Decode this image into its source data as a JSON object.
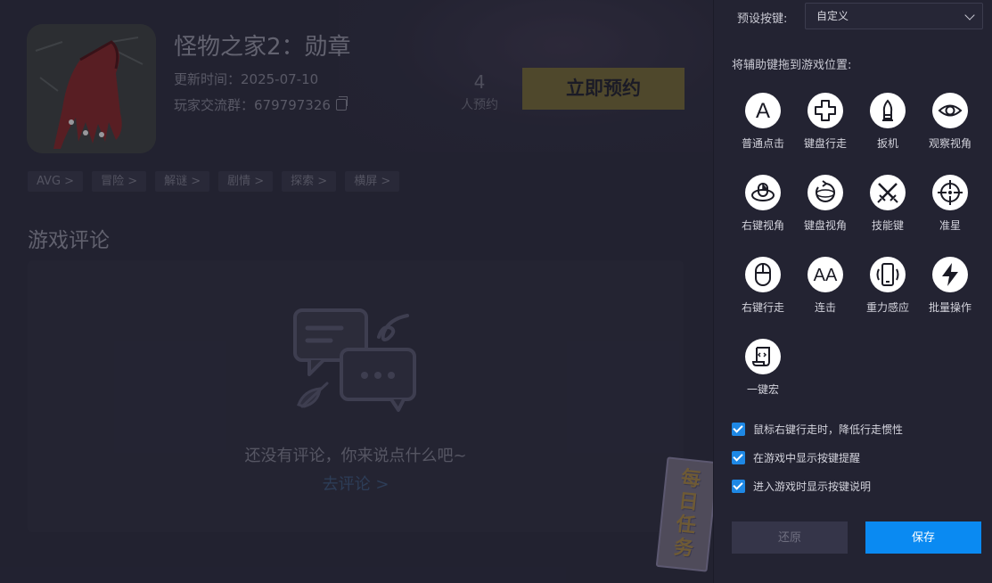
{
  "game": {
    "title": "怪物之家2：勋章",
    "update_time": "更新时间：2025-07-10",
    "group_prefix": "玩家交流群：",
    "group_number": "679797326",
    "reserve_count": "4",
    "reserve_label": "人预约",
    "reserve_button": "立即预约",
    "tags": [
      "AVG >",
      "冒险 >",
      "解谜 >",
      "剧情 >",
      "探索 >",
      "横屏 >"
    ]
  },
  "comments": {
    "section_title": "游戏评论",
    "empty_text": "还没有评论，你来说点什么吧~",
    "empty_link": "去评论 >"
  },
  "daily_badge": {
    "chars": [
      "每",
      "日",
      "任",
      "务"
    ]
  },
  "panel": {
    "preset_label": "预设按键:",
    "preset_value": "自定义",
    "drag_hint": "将辅助键拖到游戏位置:",
    "keys": [
      {
        "label": "普通点击",
        "icon": "letter-a-icon"
      },
      {
        "label": "键盘行走",
        "icon": "dpad-icon"
      },
      {
        "label": "扳机",
        "icon": "bullet-icon"
      },
      {
        "label": "观察视角",
        "icon": "eye-icon"
      },
      {
        "label": "右键视角",
        "icon": "mouse-rotate-icon"
      },
      {
        "label": "键盘视角",
        "icon": "rotate-view-icon"
      },
      {
        "label": "技能键",
        "icon": "crossed-swords-icon"
      },
      {
        "label": "准星",
        "icon": "crosshair-icon"
      },
      {
        "label": "右键行走",
        "icon": "mouse-icon"
      },
      {
        "label": "连击",
        "icon": "double-a-icon"
      },
      {
        "label": "重力感应",
        "icon": "phone-shake-icon"
      },
      {
        "label": "批量操作",
        "icon": "lightning-icon"
      },
      {
        "label": "一键宏",
        "icon": "script-icon"
      }
    ],
    "options": [
      {
        "label": "鼠标右键行走时，降低行走惯性",
        "checked": true
      },
      {
        "label": "在游戏中显示按键提醒",
        "checked": true
      },
      {
        "label": "进入游戏时显示按键说明",
        "checked": true
      }
    ],
    "restore_button": "还原",
    "save_button": "保存"
  },
  "colors": {
    "accent": "#0a8af2",
    "reserve_button": "#6f6433",
    "panel_bg": "#232332"
  }
}
